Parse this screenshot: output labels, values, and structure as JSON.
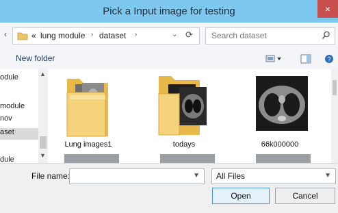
{
  "window": {
    "title": "Pick a Input image for testing",
    "close_glyph": "×",
    "accent": "#7ec8ef"
  },
  "address": {
    "back_glyph": "‹",
    "overflow": "«",
    "crumbs": [
      "lung module",
      "dataset"
    ],
    "separator": "›",
    "dropdown_glyph": "⌄",
    "refresh_glyph": "⟳"
  },
  "search": {
    "placeholder": "Search dataset"
  },
  "toolbar": {
    "new_folder": "New folder"
  },
  "nav": {
    "items": [
      "odule",
      "module",
      "nov",
      "aset",
      "dule"
    ],
    "selected_index": 3
  },
  "files": [
    {
      "name": "Lung images1",
      "kind": "folder"
    },
    {
      "name": "todays",
      "kind": "folder"
    },
    {
      "name": "66k000000",
      "kind": "image"
    }
  ],
  "bottom": {
    "file_name_label": "File name:",
    "file_name_value": "",
    "file_type_value": "All Files",
    "open_label": "Open",
    "cancel_label": "Cancel"
  }
}
